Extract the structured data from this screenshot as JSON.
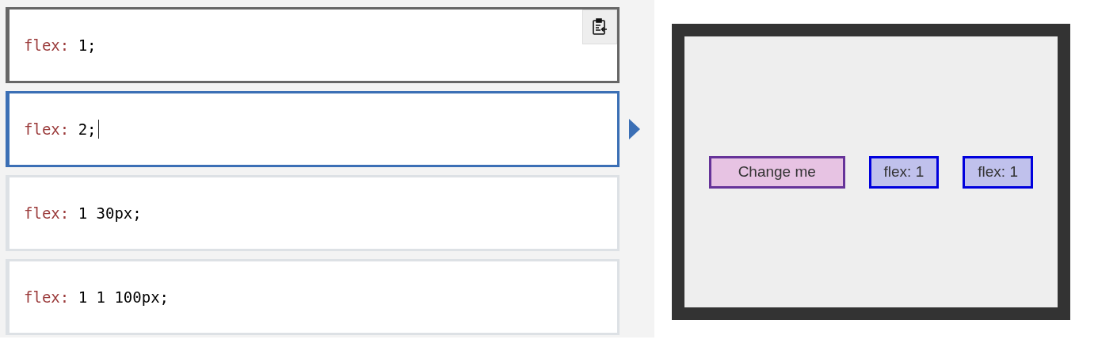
{
  "choices": [
    {
      "property": "flex:",
      "value": "1;",
      "selected": false,
      "hovered": true,
      "editing": false
    },
    {
      "property": "flex:",
      "value": "2;",
      "selected": true,
      "hovered": false,
      "editing": true
    },
    {
      "property": "flex:",
      "value": "1 30px;",
      "selected": false,
      "hovered": false,
      "editing": false
    },
    {
      "property": "flex:",
      "value": "1 1 100px;",
      "selected": false,
      "hovered": false,
      "editing": false
    }
  ],
  "output": {
    "items": [
      {
        "label": "Change me",
        "kind": "target"
      },
      {
        "label": "flex: 1",
        "kind": "plain"
      },
      {
        "label": "flex: 1",
        "kind": "plain"
      }
    ]
  }
}
